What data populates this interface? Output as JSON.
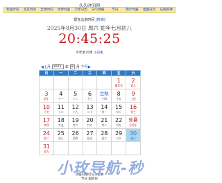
{
  "site": {
    "title": "久久时间网"
  },
  "nav": [
    "标准时间",
    "北京时间",
    "全球时间",
    "世界时差",
    "万年日历",
    "天气预报",
    "节日",
    "倒计时器",
    "桌面日历",
    "在线闹钟"
  ],
  "clock": {
    "label": "现在北京时间",
    "correct_link": "[校准]",
    "date_line": "2025年8月30日 周六 蛇年七月初八",
    "time": "20:45:25",
    "week_text": "今年第35周",
    "week_link": "小白板"
  },
  "calendar": {
    "prev_link": "◀上月",
    "year_value": "2025",
    "year_unit": "年",
    "month_value": "8",
    "month_unit": "月",
    "next_link": "下月▶",
    "headers": [
      "日",
      "一",
      "二",
      "三",
      "四",
      "五",
      "六"
    ],
    "rows": [
      [
        null,
        null,
        null,
        null,
        null,
        {
          "d": "1",
          "l": "建军节",
          "c": "red"
        },
        {
          "d": "2",
          "l": "初九",
          "c": "red"
        }
      ],
      [
        {
          "d": "3",
          "l": "初十",
          "c": "red"
        },
        {
          "d": "4",
          "l": "十一"
        },
        {
          "d": "5",
          "l": "十二"
        },
        {
          "d": "6",
          "l": "十三"
        },
        {
          "d": "立秋",
          "l": "十四",
          "c": "term"
        },
        {
          "d": "8",
          "l": "十五"
        },
        {
          "d": "9",
          "l": "三伏",
          "c": "red"
        }
      ],
      [
        {
          "d": "10",
          "l": "十七",
          "c": "red"
        },
        {
          "d": "11",
          "l": "十八"
        },
        {
          "d": "12",
          "l": "十九"
        },
        {
          "d": "13",
          "l": "二十"
        },
        {
          "d": "14",
          "l": "廿一"
        },
        {
          "d": "15",
          "l": "廿二"
        },
        {
          "d": "16",
          "l": "廿三",
          "c": "red"
        }
      ],
      [
        {
          "d": "17",
          "l": "廿四",
          "c": "red"
        },
        {
          "d": "18",
          "l": "廿五"
        },
        {
          "d": "19",
          "l": "廿六"
        },
        {
          "d": "20",
          "l": "廿七"
        },
        {
          "d": "21",
          "l": "廿八"
        },
        {
          "d": "22",
          "l": "廿九"
        },
        {
          "d": "处暑",
          "l": "七月小",
          "c": "hl"
        }
      ],
      [
        {
          "d": "24",
          "l": "初二",
          "c": "red"
        },
        {
          "d": "25",
          "l": "初三"
        },
        {
          "d": "26",
          "l": "初四"
        },
        {
          "d": "27",
          "l": "初五"
        },
        {
          "d": "28",
          "l": "初六"
        },
        {
          "d": "29",
          "l": "七夕"
        },
        {
          "d": "30",
          "l": "初八",
          "c": "today"
        }
      ],
      [
        {
          "d": "31",
          "l": "初九",
          "c": "red"
        },
        null,
        null,
        null,
        null,
        null,
        null
      ]
    ]
  },
  "footer": {
    "line1": "点击日期可写入记事",
    "line2": "节日 国际日"
  },
  "watermark": "小玫导航-秒"
}
